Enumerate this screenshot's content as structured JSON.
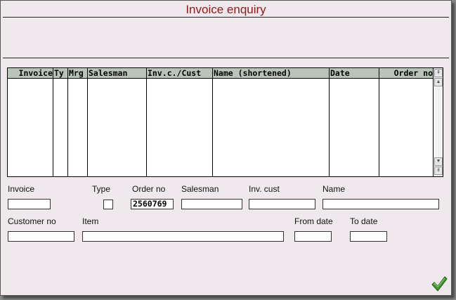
{
  "window": {
    "title": "Invoice enquiry"
  },
  "grid": {
    "columns": [
      "Invoice",
      "Ty",
      "Mrg",
      "Salesman",
      "Inv.c./Cust",
      "Name (shortened)",
      "Date",
      "Order no"
    ],
    "scroll_up_glyph": "▲",
    "scroll_down_glyph": "▼",
    "scroll_jump_top_glyph": "⇞",
    "scroll_jump_bottom_glyph": "⇟"
  },
  "form": {
    "invoice": {
      "label": "Invoice",
      "value": ""
    },
    "type": {
      "label": "Type",
      "checked": false
    },
    "order_no": {
      "label": "Order no",
      "value": "2560769"
    },
    "salesman": {
      "label": "Salesman",
      "value": ""
    },
    "inv_cust": {
      "label": "Inv. cust",
      "value": ""
    },
    "name": {
      "label": "Name",
      "value": ""
    },
    "customer_no": {
      "label": "Customer no",
      "value": ""
    },
    "item": {
      "label": "Item",
      "value": ""
    },
    "from_date": {
      "label": "From date",
      "value": ""
    },
    "to_date": {
      "label": "To date",
      "value": ""
    }
  },
  "actions": {
    "ok_icon": "green-checkmark-icon"
  },
  "colors": {
    "title": "#8b1a1a",
    "background": "#efe9ee",
    "grid_header": "#b8c4b8",
    "ok_green": "#3f9a2e"
  }
}
